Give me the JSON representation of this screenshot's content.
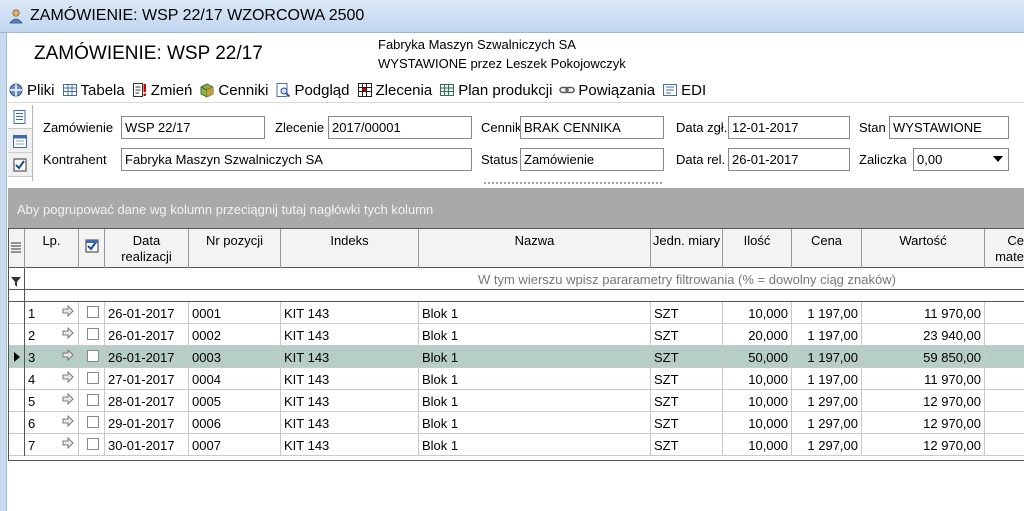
{
  "window": {
    "title": "ZAMÓWIENIE: WSP 22/17 WZORCOWA 2500"
  },
  "header": {
    "title": "ZAMÓWIENIE: WSP 22/17",
    "company": "Fabryka Maszyn Szwalniczych SA",
    "issued": "WYSTAWIONE przez Leszek Pokojowczyk"
  },
  "toolbar": {
    "items": [
      {
        "label": "Pliki",
        "icon": "files-icon"
      },
      {
        "label": "Tabela",
        "icon": "table-icon"
      },
      {
        "label": "Zmień",
        "icon": "edit-icon"
      },
      {
        "label": "Cenniki",
        "icon": "pricelist-icon"
      },
      {
        "label": "Podgląd",
        "icon": "preview-icon"
      },
      {
        "label": "Zlecenia",
        "icon": "orders-icon"
      },
      {
        "label": "Plan produkcji",
        "icon": "production-plan-icon"
      },
      {
        "label": "Powiązania",
        "icon": "link-icon"
      },
      {
        "label": "EDI",
        "icon": "edi-icon"
      }
    ]
  },
  "form": {
    "zamowienie": {
      "label": "Zamówienie",
      "value": "WSP 22/17"
    },
    "zlecenie": {
      "label": "Zlecenie",
      "value": "2017/00001"
    },
    "cennik": {
      "label": "Cennik",
      "value": "BRAK CENNIKA"
    },
    "data_zgl": {
      "label": "Data zgł.",
      "value": "12-01-2017"
    },
    "stan": {
      "label": "Stan",
      "value": "WYSTAWIONE"
    },
    "kontrahent": {
      "label": "Kontrahent",
      "value": "Fabryka Maszyn Szwalniczych SA"
    },
    "status": {
      "label": "Status",
      "value": "Zamówienie"
    },
    "data_rel": {
      "label": "Data rel.",
      "value": "26-01-2017"
    },
    "zaliczka": {
      "label": "Zaliczka",
      "value": "0,00"
    }
  },
  "grid": {
    "group_hint": "Aby pogrupować dane wg kolumn przeciągnij tutaj nagłówki tych kolumn",
    "filter_hint": "W tym wierszu wpisz pararametry filtrowania (% = dowolny ciąg znaków)",
    "columns": {
      "lp": "Lp.",
      "data_realizacji_1": "Data",
      "data_realizacji_2": "realizacji",
      "nr_pozycji": "Nr pozycji",
      "indeks": "Indeks",
      "nazwa": "Nazwa",
      "jedn_miary": "Jedn. miary",
      "ilosc": "Ilość",
      "cena": "Cena",
      "wartosc": "Wartość",
      "cena_mat_1": "Ce",
      "cena_mat_2": "mate"
    },
    "rows": [
      {
        "lp": "1",
        "data": "26-01-2017",
        "nr": "0001",
        "indeks": "KIT 143",
        "nazwa": "Blok 1",
        "jm": "SZT",
        "ilosc": "10,000",
        "cena": "1 197,00",
        "wartosc": "11 970,00"
      },
      {
        "lp": "2",
        "data": "26-01-2017",
        "nr": "0002",
        "indeks": "KIT 143",
        "nazwa": "Blok 1",
        "jm": "SZT",
        "ilosc": "20,000",
        "cena": "1 197,00",
        "wartosc": "23 940,00"
      },
      {
        "lp": "3",
        "data": "26-01-2017",
        "nr": "0003",
        "indeks": "KIT 143",
        "nazwa": "Blok 1",
        "jm": "SZT",
        "ilosc": "50,000",
        "cena": "1 197,00",
        "wartosc": "59 850,00"
      },
      {
        "lp": "4",
        "data": "27-01-2017",
        "nr": "0004",
        "indeks": "KIT 143",
        "nazwa": "Blok 1",
        "jm": "SZT",
        "ilosc": "10,000",
        "cena": "1 197,00",
        "wartosc": "11 970,00"
      },
      {
        "lp": "5",
        "data": "28-01-2017",
        "nr": "0005",
        "indeks": "KIT 143",
        "nazwa": "Blok 1",
        "jm": "SZT",
        "ilosc": "10,000",
        "cena": "1 297,00",
        "wartosc": "12 970,00"
      },
      {
        "lp": "6",
        "data": "29-01-2017",
        "nr": "0006",
        "indeks": "KIT 143",
        "nazwa": "Blok 1",
        "jm": "SZT",
        "ilosc": "10,000",
        "cena": "1 297,00",
        "wartosc": "12 970,00"
      },
      {
        "lp": "7",
        "data": "30-01-2017",
        "nr": "0007",
        "indeks": "KIT 143",
        "nazwa": "Blok 1",
        "jm": "SZT",
        "ilosc": "10,000",
        "cena": "1 297,00",
        "wartosc": "12 970,00"
      }
    ],
    "selected_row": 3
  }
}
